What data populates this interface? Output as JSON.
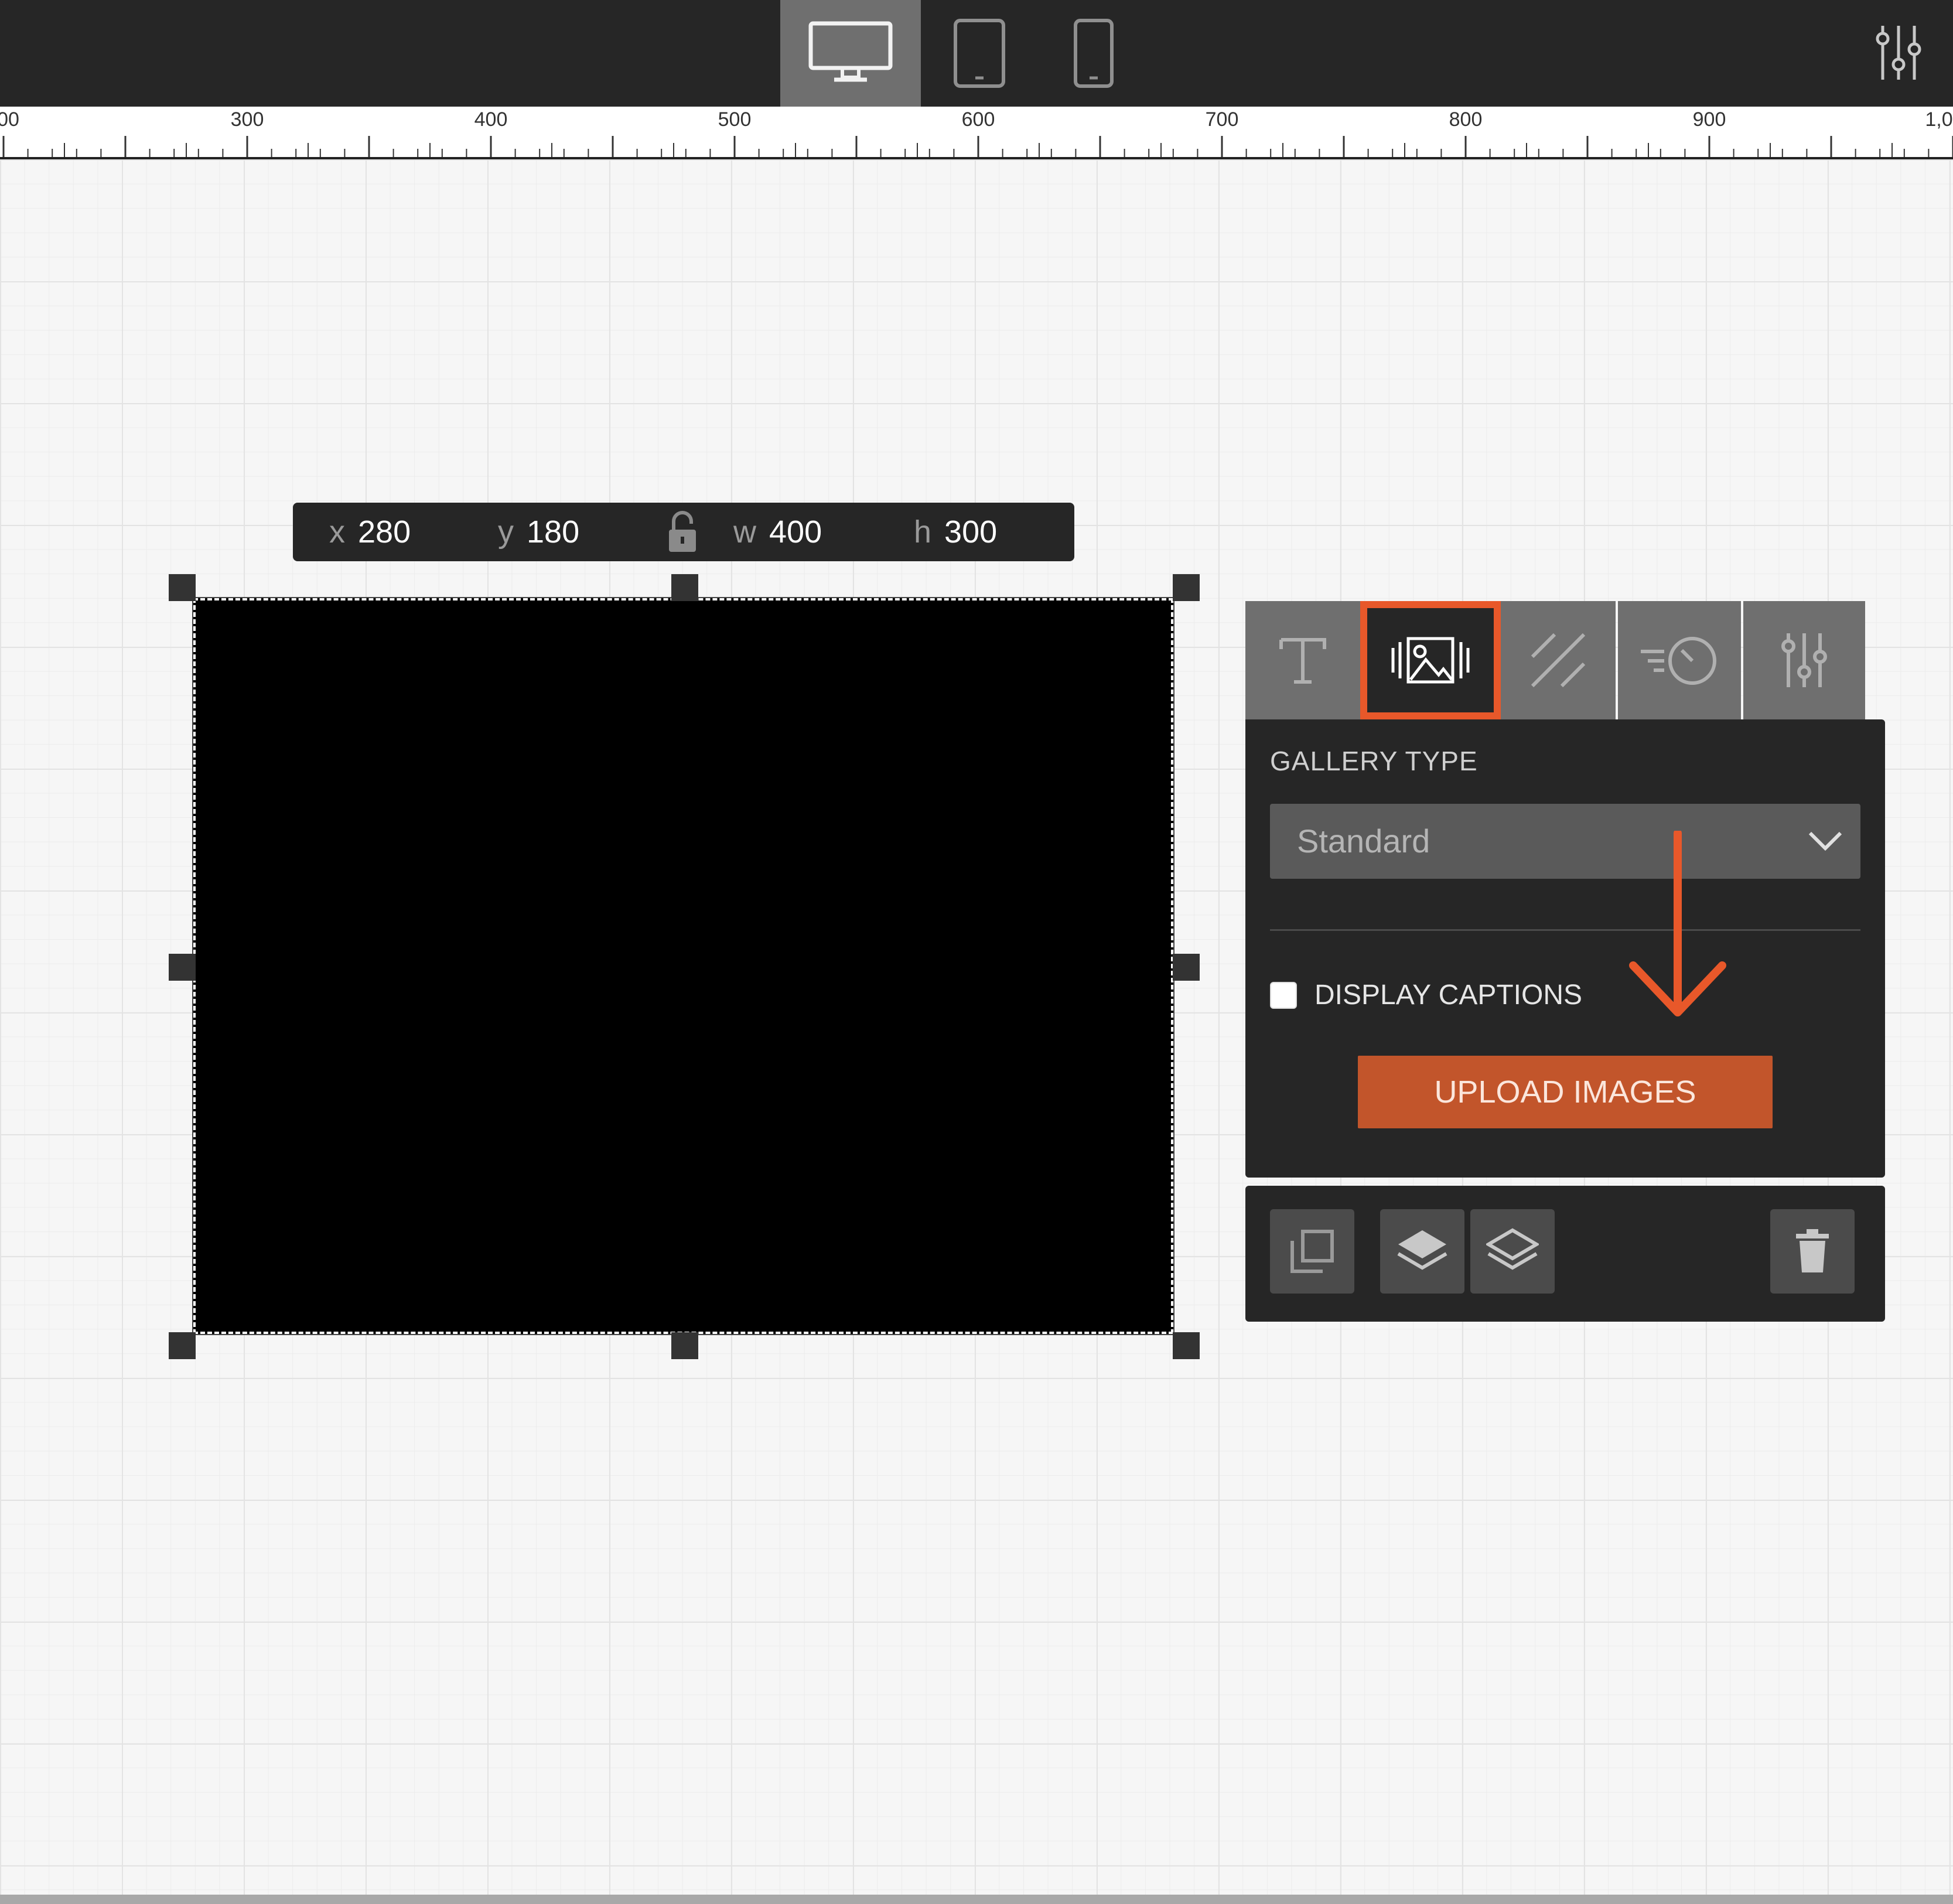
{
  "toolbar": {
    "devices": [
      {
        "name": "desktop",
        "active": true
      },
      {
        "name": "tablet",
        "active": false
      },
      {
        "name": "phone",
        "active": false
      }
    ],
    "settings_icon": "sliders-icon"
  },
  "ruler": {
    "labels": [
      "00",
      "300",
      "400",
      "500",
      "600",
      "700",
      "800",
      "900",
      "1,0"
    ]
  },
  "coords": {
    "x_label": "x",
    "x_value": "280",
    "y_label": "y",
    "y_value": "180",
    "lock_icon": "unlocked-padlock-icon",
    "w_label": "w",
    "w_value": "400",
    "h_label": "h",
    "h_value": "300"
  },
  "panel": {
    "tabs": [
      {
        "name": "text-tab",
        "icon": "text-T-icon",
        "active": false
      },
      {
        "name": "gallery-tab",
        "icon": "gallery-image-icon",
        "active": true
      },
      {
        "name": "background-tab",
        "icon": "diagonal-lines-icon",
        "active": false
      },
      {
        "name": "animation-tab",
        "icon": "timer-motion-icon",
        "active": false
      },
      {
        "name": "settings-tab",
        "icon": "sliders-icon",
        "active": false
      }
    ],
    "gallery_type_label": "GALLERY TYPE",
    "gallery_type_value": "Standard",
    "display_captions_label": "DISPLAY CAPTIONS",
    "display_captions_checked": false,
    "upload_label": "UPLOAD IMAGES"
  },
  "actions": {
    "duplicate_icon": "duplicate-icon",
    "bring_forward_icon": "layer-up-icon",
    "send_backward_icon": "layer-down-icon",
    "delete_icon": "trash-icon"
  },
  "colors": {
    "accent": "#e8582a",
    "upload_button": "#c2552b",
    "toolbar_bg": "#262626"
  }
}
